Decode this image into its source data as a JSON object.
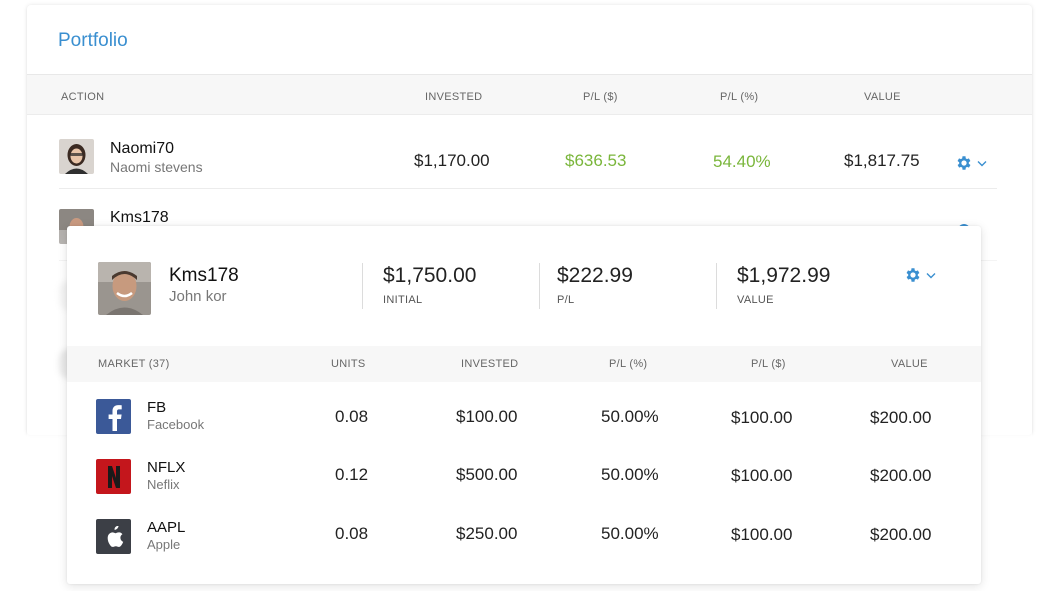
{
  "portfolio": {
    "title": "Portfolio",
    "columns": [
      "ACTION",
      "INVESTED",
      "P/L ($)",
      "P/L (%)",
      "VALUE"
    ],
    "rows": [
      {
        "username": "Naomi70",
        "full_name": "Naomi stevens",
        "invested": "$1,170.00",
        "pl_usd": "$636.53",
        "pl_pct": "54.40%",
        "value": "$1,817.75"
      },
      {
        "username": "Kms178"
      }
    ]
  },
  "detail": {
    "username": "Kms178",
    "full_name": "John kor",
    "initial": "$1,750.00",
    "initial_label": "INITIAL",
    "pl": "$222.99",
    "pl_label": "P/L",
    "value": "$1,972.99",
    "value_label": "VALUE",
    "columns": [
      "MARKET (37)",
      "UNITS",
      "INVESTED",
      "P/L (%)",
      "P/L ($)",
      "VALUE"
    ],
    "markets": [
      {
        "symbol": "FB",
        "name": "Facebook",
        "units": "0.08",
        "invested": "$100.00",
        "pl_pct": "50.00%",
        "pl_usd": "$100.00",
        "value": "$200.00",
        "icon": "facebook-icon"
      },
      {
        "symbol": "NFLX",
        "name": "Neflix",
        "units": "0.12",
        "invested": "$500.00",
        "pl_pct": "50.00%",
        "pl_usd": "$100.00",
        "value": "$200.00",
        "icon": "netflix-icon"
      },
      {
        "symbol": "AAPL",
        "name": "Apple",
        "units": "0.08",
        "invested": "$250.00",
        "pl_pct": "50.00%",
        "pl_usd": "$100.00",
        "value": "$200.00",
        "icon": "apple-icon"
      }
    ]
  },
  "colors": {
    "accent": "#3a8fd0",
    "positive": "#7ab63b",
    "facebook": "#3b5998",
    "netflix": "#c4161c",
    "apple": "#3c3f46"
  }
}
